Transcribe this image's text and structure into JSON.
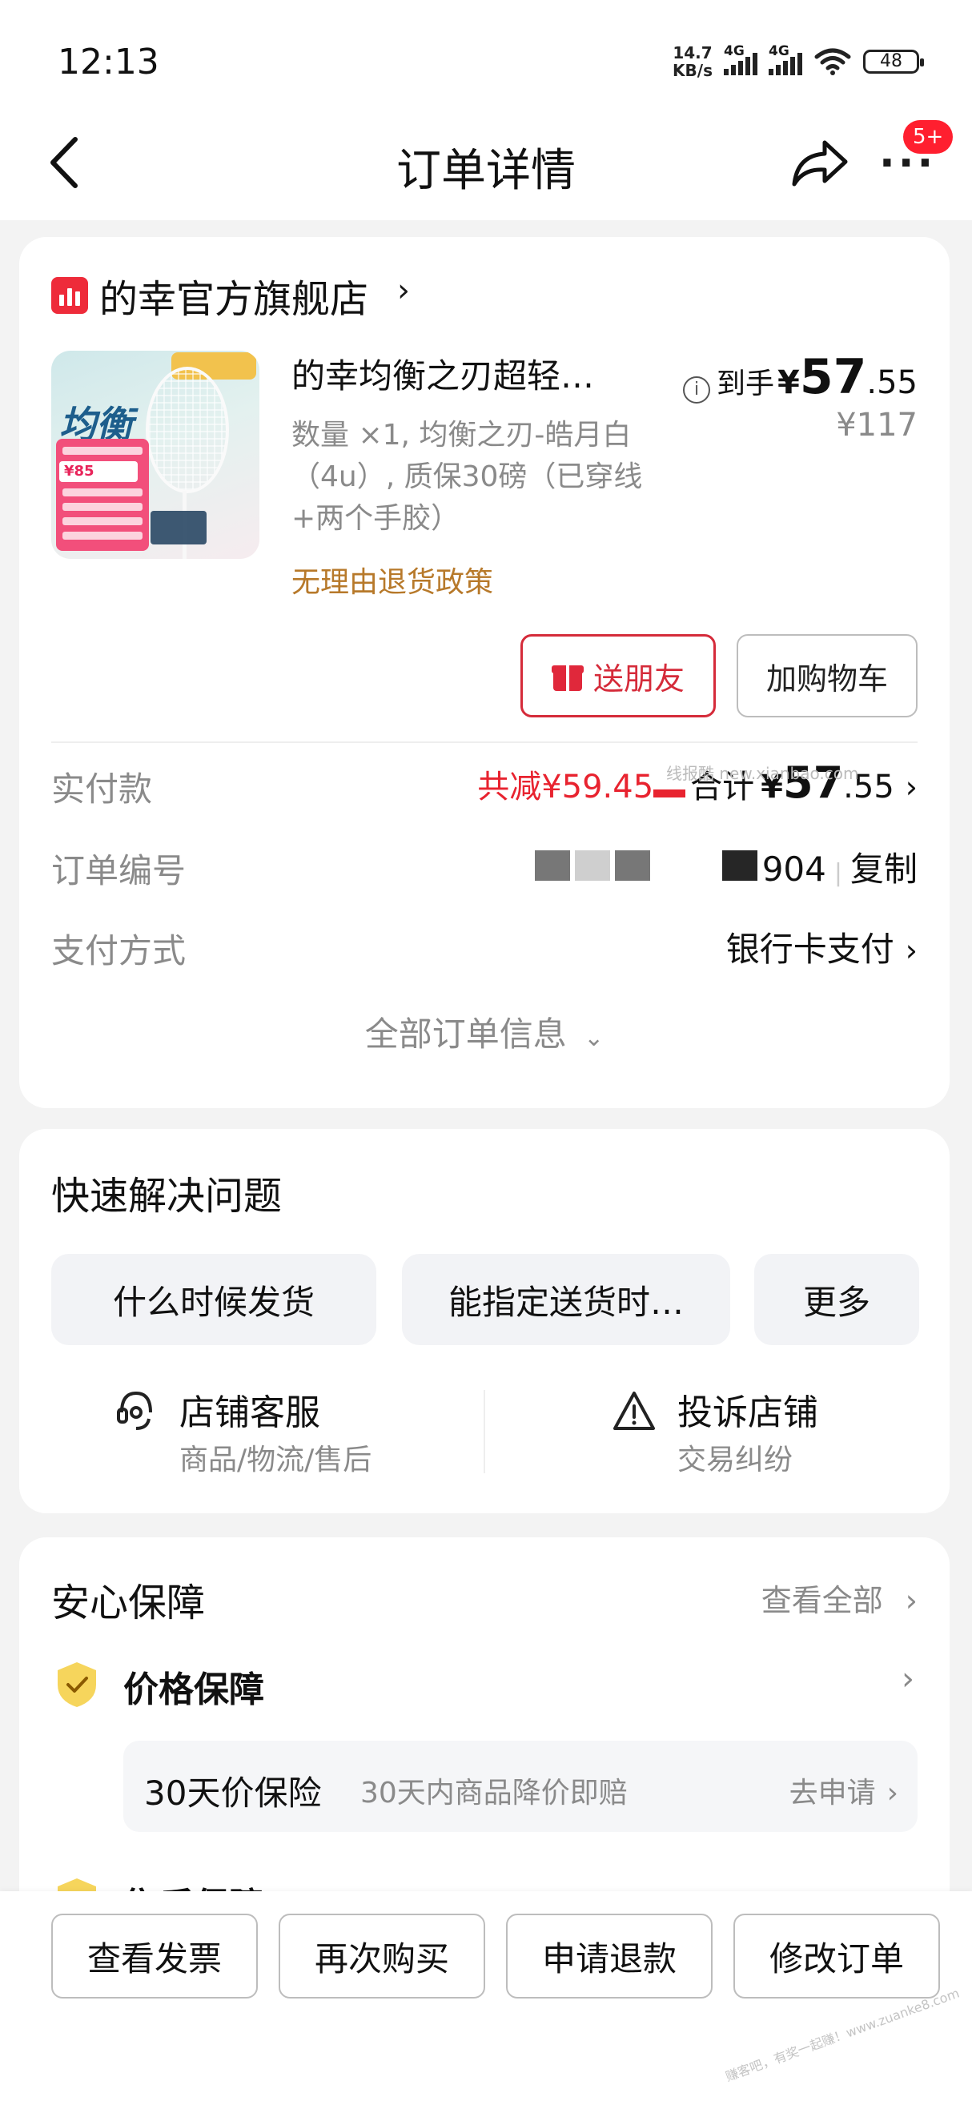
{
  "status_bar": {
    "time": "12:13",
    "net_speed": "14.7",
    "net_unit": "KB/s",
    "signal1": "4G",
    "signal2": "4G",
    "battery": "48"
  },
  "nav": {
    "title": "订单详情",
    "badge": "5+",
    "more": "···"
  },
  "order_card": {
    "store_name": "的幸官方旗舰店",
    "product": {
      "title": "的幸均衡之刃超轻…",
      "spec": "数量 ×1, 均衡之刃-皓月白（4u）, 质保30磅（已穿线+两个手胶）",
      "policy": "无理由退货政策",
      "price_label": "到手",
      "price_currency": "¥",
      "price_int": "57",
      "price_dec": ".55",
      "original_price": "¥117",
      "thumb_text": "均衡",
      "thumb_price": "¥85"
    },
    "buttons": {
      "gift": "送朋友",
      "cart": "加购物车"
    },
    "paid": {
      "label": "实付款",
      "discount_text": "共减¥59.45",
      "total_label": "合计",
      "total_currency": "¥",
      "total_int": "57",
      "total_dec": ".55"
    },
    "order_no": {
      "label": "订单编号",
      "value_tail": "904",
      "copy": "复制"
    },
    "payment": {
      "label": "支付方式",
      "value": "银行卡支付"
    },
    "all_info": "全部订单信息",
    "watermark": "线报酷 new.xianbao.com"
  },
  "quick": {
    "title": "快速解决问题",
    "chips": [
      "什么时候发货",
      "能指定送货时…",
      "更多"
    ],
    "services": [
      {
        "title": "店铺客服",
        "sub": "商品/物流/售后"
      },
      {
        "title": "投诉店铺",
        "sub": "交易纠纷"
      }
    ]
  },
  "guarantee": {
    "title": "安心保障",
    "see_all": "查看全部",
    "items": [
      {
        "title": "价格保障"
      },
      {
        "title": "售后保障"
      }
    ],
    "price_protect": {
      "title": "30天价保险",
      "desc": "30天内商品降价即赔",
      "action": "去申请"
    }
  },
  "bottom_bar": {
    "buttons": [
      "查看发票",
      "再次购买",
      "申请退款",
      "修改订单"
    ]
  },
  "corner_watermark": "赚客吧，有奖一起赚！www.zuanke8.com",
  "colors": {
    "accent_red": "#e8232f",
    "store_icon": "#ee2b3a",
    "policy_orange": "#b7792a",
    "shield_yellow": "#f6d55c"
  }
}
